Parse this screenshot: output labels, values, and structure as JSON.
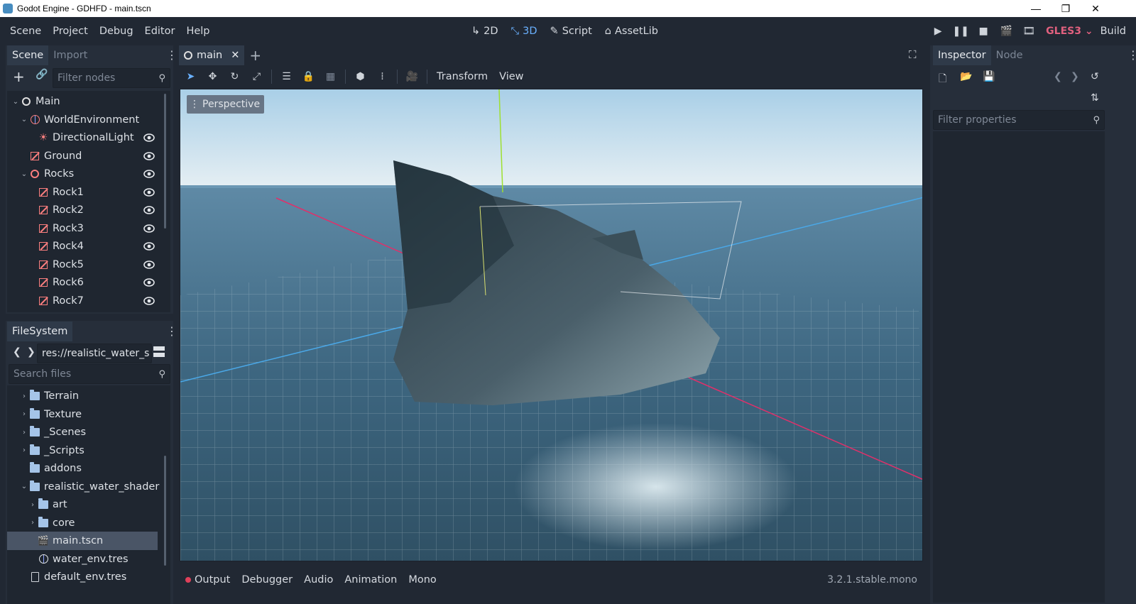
{
  "window": {
    "title": "Godot Engine - GDHFD - main.tscn"
  },
  "menubar": {
    "menus": [
      "Scene",
      "Project",
      "Debug",
      "Editor",
      "Help"
    ],
    "modes": [
      "2D",
      "3D",
      "Script",
      "AssetLib"
    ],
    "active_mode": "3D",
    "renderer": "GLES3",
    "build": "Build"
  },
  "scene_dock": {
    "tabs": [
      "Scene",
      "Import"
    ],
    "filter_placeholder": "Filter nodes",
    "nodes": [
      {
        "label": "Main",
        "icon": "node3d-icon",
        "expanded": true,
        "eye": false
      },
      {
        "label": "WorldEnvironment",
        "icon": "world-environment-icon",
        "expanded": true,
        "eye": false
      },
      {
        "label": "DirectionalLight",
        "icon": "directional-light-icon",
        "eye": true
      },
      {
        "label": "Ground",
        "icon": "mesh-instance-icon",
        "eye": true
      },
      {
        "label": "Rocks",
        "icon": "spatial-icon",
        "expanded": true,
        "eye": true
      },
      {
        "label": "Rock1",
        "icon": "mesh-instance-icon",
        "eye": true
      },
      {
        "label": "Rock2",
        "icon": "mesh-instance-icon",
        "eye": true
      },
      {
        "label": "Rock3",
        "icon": "mesh-instance-icon",
        "eye": true
      },
      {
        "label": "Rock4",
        "icon": "mesh-instance-icon",
        "eye": true
      },
      {
        "label": "Rock5",
        "icon": "mesh-instance-icon",
        "eye": true
      },
      {
        "label": "Rock6",
        "icon": "mesh-instance-icon",
        "eye": true
      },
      {
        "label": "Rock7",
        "icon": "mesh-instance-icon",
        "eye": true
      }
    ]
  },
  "filesystem": {
    "title": "FileSystem",
    "path": "res://realistic_water_s",
    "search_placeholder": "Search files",
    "items": [
      {
        "label": "Terrain",
        "type": "folder",
        "collapsed": true
      },
      {
        "label": "Texture",
        "type": "folder",
        "collapsed": true
      },
      {
        "label": "_Scenes",
        "type": "folder",
        "collapsed": true
      },
      {
        "label": "_Scripts",
        "type": "folder",
        "collapsed": true
      },
      {
        "label": "addons",
        "type": "folder"
      },
      {
        "label": "realistic_water_shader",
        "type": "folder",
        "expanded": true
      },
      {
        "label": "art",
        "type": "folder",
        "collapsed": true
      },
      {
        "label": "core",
        "type": "folder",
        "collapsed": true
      },
      {
        "label": "main.tscn",
        "type": "scene",
        "selected": true
      },
      {
        "label": "water_env.tres",
        "type": "resource"
      },
      {
        "label": "default_env.tres",
        "type": "file"
      }
    ]
  },
  "editor": {
    "scene_tab": "main",
    "toolbar_menus": [
      "Transform",
      "View"
    ],
    "viewport_label": "Perspective"
  },
  "bottom_panel": {
    "tabs": [
      "Output",
      "Debugger",
      "Audio",
      "Animation",
      "Mono"
    ],
    "version": "3.2.1.stable.mono"
  },
  "inspector": {
    "tabs": [
      "Inspector",
      "Node"
    ],
    "filter_placeholder": "Filter properties"
  },
  "colors": {
    "accent": "#6ab1ff",
    "background": "#212833",
    "panel": "#262e3a",
    "renderer": "#e0607e"
  }
}
